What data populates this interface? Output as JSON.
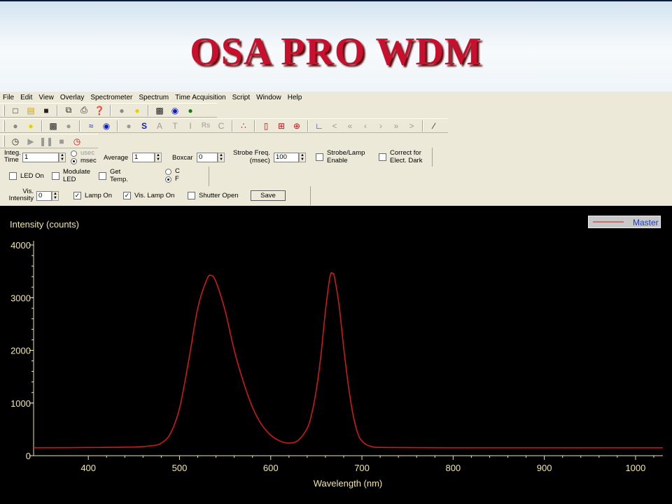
{
  "slide": {
    "title": "OSA PRO WDM"
  },
  "menu": [
    "File",
    "Edit",
    "View",
    "Overlay",
    "Spectrometer",
    "Spectrum",
    "Time Acquisition",
    "Script",
    "Window",
    "Help"
  ],
  "toolbar_text": {
    "s": "S",
    "a": "A",
    "t": "T",
    "i": "I",
    "rs": "Rs",
    "c": "C"
  },
  "controls": {
    "integ_label_1": "Integ.",
    "integ_label_2": "Time",
    "integ_value": "1",
    "usec_label": "usec",
    "msec_label": "msec",
    "average_label": "Average",
    "average_value": "1",
    "boxcar_label": "Boxcar",
    "boxcar_value": "0",
    "strobe_label_1": "Strobe Freq.",
    "strobe_label_2": "(msec)",
    "strobe_value": "100",
    "strobe_lamp_1": "Strobe/Lamp",
    "strobe_lamp_2": "Enable",
    "correct_1": "Correct for",
    "correct_2": "Elect. Dark",
    "led_on": "LED On",
    "modulate_1": "Modulate",
    "modulate_2": "LED",
    "get_temp_1": "Get",
    "get_temp_2": "Temp.",
    "temp_c": "C",
    "temp_f": "F",
    "vis_1": "Vis.",
    "vis_2": "Intensity",
    "vis_value": "0",
    "lamp_on": "Lamp On",
    "vis_lamp_on": "Vis. Lamp On",
    "shutter_open": "Shutter Open",
    "save": "Save"
  },
  "chart_data": {
    "type": "line",
    "title": "",
    "xlabel": "Wavelength (nm)",
    "ylabel": "Intensity (counts)",
    "xlim": [
      340,
      1030
    ],
    "ylim": [
      0,
      4000
    ],
    "x_ticks": [
      400,
      500,
      600,
      700,
      800,
      900,
      1000
    ],
    "y_ticks": [
      0,
      1000,
      2000,
      3000,
      4000
    ],
    "legend": "top-right",
    "series": [
      {
        "name": "Master",
        "color": "#cc1a1a",
        "x": [
          340,
          400,
          450,
          470,
          480,
          490,
          500,
          510,
          520,
          530,
          535,
          540,
          550,
          560,
          570,
          580,
          590,
          600,
          610,
          620,
          630,
          640,
          645,
          650,
          655,
          660,
          665,
          668,
          670,
          675,
          680,
          685,
          690,
          695,
          700,
          710,
          730,
          800,
          900,
          1030
        ],
        "y": [
          150,
          155,
          165,
          190,
          240,
          420,
          900,
          1800,
          2800,
          3350,
          3420,
          3300,
          2750,
          2000,
          1400,
          920,
          590,
          390,
          280,
          240,
          290,
          520,
          800,
          1250,
          1900,
          2750,
          3400,
          3460,
          3380,
          2850,
          2050,
          1350,
          800,
          450,
          280,
          175,
          155,
          150,
          150,
          150
        ]
      }
    ]
  },
  "colors": {
    "axis": "#f0e6a8",
    "trace": "#cc1a1a",
    "title": "#c8102e"
  }
}
